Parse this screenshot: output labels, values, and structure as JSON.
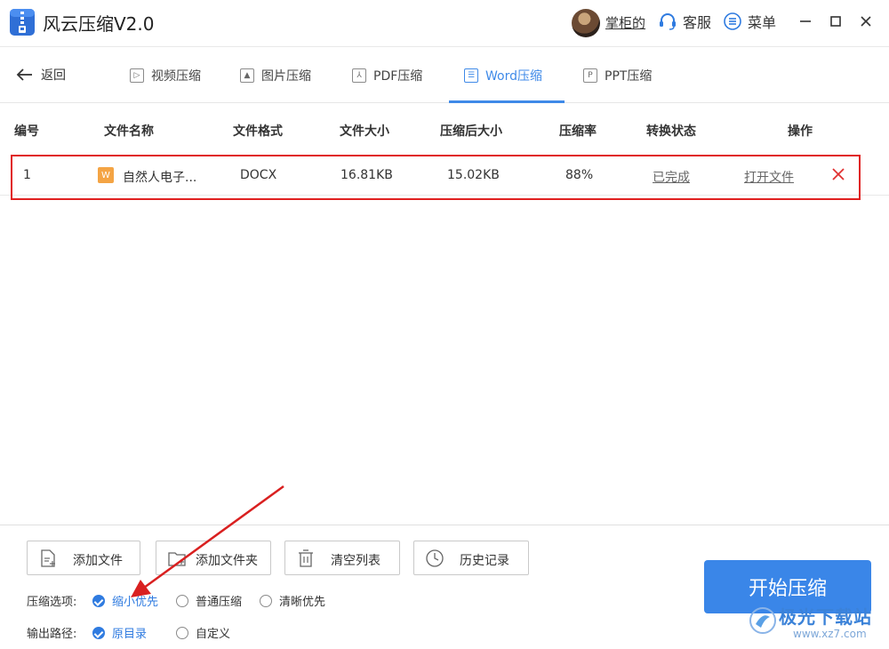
{
  "app": {
    "title": "风云压缩V2.0",
    "user_name": "掌柜的",
    "service_label": "客服",
    "menu_label": "菜单"
  },
  "nav": {
    "back_label": "返回",
    "tabs": [
      {
        "label": "视频压缩",
        "icon": "video-icon",
        "active": false
      },
      {
        "label": "图片压缩",
        "icon": "image-icon",
        "active": false
      },
      {
        "label": "PDF压缩",
        "icon": "pdf-icon",
        "active": false
      },
      {
        "label": "Word压缩",
        "icon": "word-icon",
        "active": true
      },
      {
        "label": "PPT压缩",
        "icon": "ppt-icon",
        "active": false
      }
    ]
  },
  "table": {
    "headers": [
      "编号",
      "文件名称",
      "文件格式",
      "文件大小",
      "压缩后大小",
      "压缩率",
      "转换状态",
      "操作"
    ],
    "rows": [
      {
        "index": "1",
        "file_name": "自然人电子...",
        "format": "DOCX",
        "size": "16.81KB",
        "compressed_size": "15.02KB",
        "ratio": "88%",
        "status": "已完成",
        "action": "打开文件"
      }
    ]
  },
  "toolbar": {
    "add_file": "添加文件",
    "add_folder": "添加文件夹",
    "clear_list": "清空列表",
    "history": "历史记录"
  },
  "options": {
    "compress_label": "压缩选项:",
    "compress_options": [
      {
        "label": "缩小优先",
        "checked": true
      },
      {
        "label": "普通压缩",
        "checked": false
      },
      {
        "label": "清晰优先",
        "checked": false
      }
    ],
    "output_label": "输出路径:",
    "output_options": [
      {
        "label": "原目录",
        "checked": true
      },
      {
        "label": "自定义",
        "checked": false
      }
    ]
  },
  "start_button": "开始压缩",
  "watermark": {
    "name": "极光下载站",
    "url": "www.xz7.com"
  },
  "colors": {
    "accent": "#3a86e8",
    "highlight_border": "#e02020",
    "word_badge": "#f4a444"
  }
}
